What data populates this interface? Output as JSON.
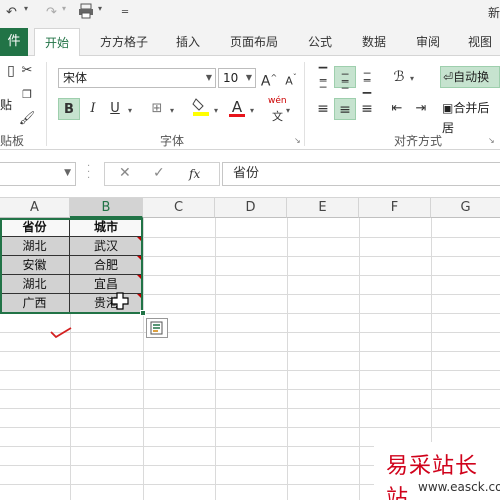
{
  "qat": {
    "title_fragment": "新"
  },
  "tabs": [
    {
      "label": "件",
      "active": false
    },
    {
      "label": "开始",
      "active": true
    },
    {
      "label": "方方格子",
      "active": false
    },
    {
      "label": "插入",
      "active": false
    },
    {
      "label": "页面布局",
      "active": false
    },
    {
      "label": "公式",
      "active": false
    },
    {
      "label": "数据",
      "active": false
    },
    {
      "label": "审阅",
      "active": false
    },
    {
      "label": "视图",
      "active": false
    }
  ],
  "ribbon": {
    "clipboard_label": "贴板",
    "paste_text": "贴",
    "font_group_label": "字体",
    "font_name": "宋体",
    "font_size": "10",
    "bold": "B",
    "italic": "I",
    "underline": "U",
    "font_color_letter": "A",
    "wen_label": "wén",
    "wen_char": "文",
    "alignment_label": "对齐方式",
    "wrap_text": "自动换",
    "merge_text": "合并后居",
    "accent_color": "#217346"
  },
  "formula_bar": {
    "name_box": "",
    "fx": "fx",
    "value": "省份"
  },
  "columns": [
    "A",
    "B",
    "C",
    "D",
    "E",
    "F",
    "G"
  ],
  "table": {
    "headers": [
      "省份",
      "城市"
    ],
    "rows": [
      [
        "湖北",
        "武汉"
      ],
      [
        "安徽",
        "合肥"
      ],
      [
        "湖北",
        "宜昌"
      ],
      [
        "广西",
        "贵港"
      ]
    ]
  },
  "watermark": {
    "chinese": "易采站长站",
    "url": "www.easck.com"
  }
}
